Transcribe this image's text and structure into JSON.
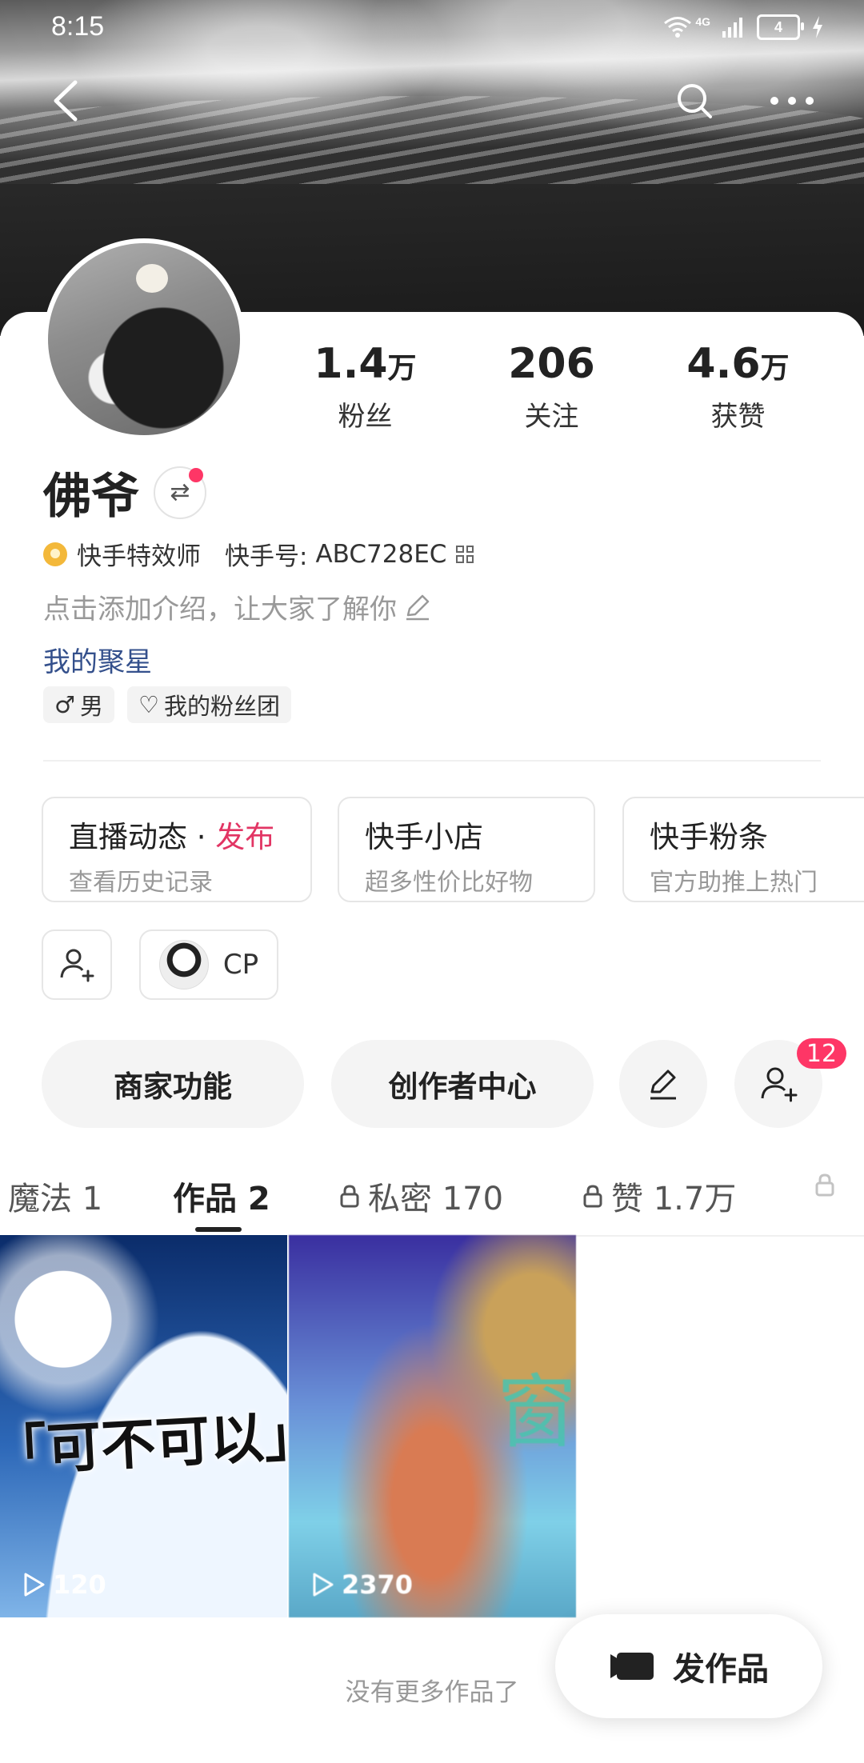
{
  "status_bar": {
    "time": "8:15",
    "network": "4G",
    "battery": "4"
  },
  "profile": {
    "name": "佛爷",
    "stats": [
      {
        "value": "1.4",
        "unit": "万",
        "label": "粉丝"
      },
      {
        "value": "206",
        "unit": "",
        "label": "关注"
      },
      {
        "value": "4.6",
        "unit": "万",
        "label": "获赞"
      }
    ],
    "badge_title": "快手特效师",
    "id_label": "快手号:",
    "id_value": "ABC728EC",
    "bio_placeholder": "点击添加介绍，让大家了解你",
    "link_text": "我的聚星",
    "tags": {
      "gender": "男",
      "fan_group": "我的粉丝团"
    }
  },
  "features": [
    {
      "title": "直播动态",
      "separator": "·",
      "action": "发布",
      "subtitle": "查看历史记录"
    },
    {
      "title": "快手小店",
      "subtitle": "超多性价比好物"
    },
    {
      "title": "快手粉条",
      "subtitle": "官方助推上热门"
    }
  ],
  "cp": {
    "label": "CP"
  },
  "actions": {
    "merchant": "商家功能",
    "creator": "创作者中心",
    "notification_count": "12"
  },
  "tabs": [
    {
      "label": "魔法 1",
      "locked": false
    },
    {
      "label": "作品 2",
      "locked": false,
      "active": true
    },
    {
      "label": "私密 170",
      "locked": true
    },
    {
      "label": "赞 1.7万",
      "locked": true
    }
  ],
  "videos": [
    {
      "caption": "「可不可以」",
      "plays": "120"
    },
    {
      "caption": "窗",
      "plays": "2370"
    }
  ],
  "footer": {
    "no_more": "没有更多作品了",
    "publish": "发作品"
  },
  "colors": {
    "accent_red": "#fe3666",
    "link_blue": "#34508c",
    "publish_red": "#e23564"
  }
}
